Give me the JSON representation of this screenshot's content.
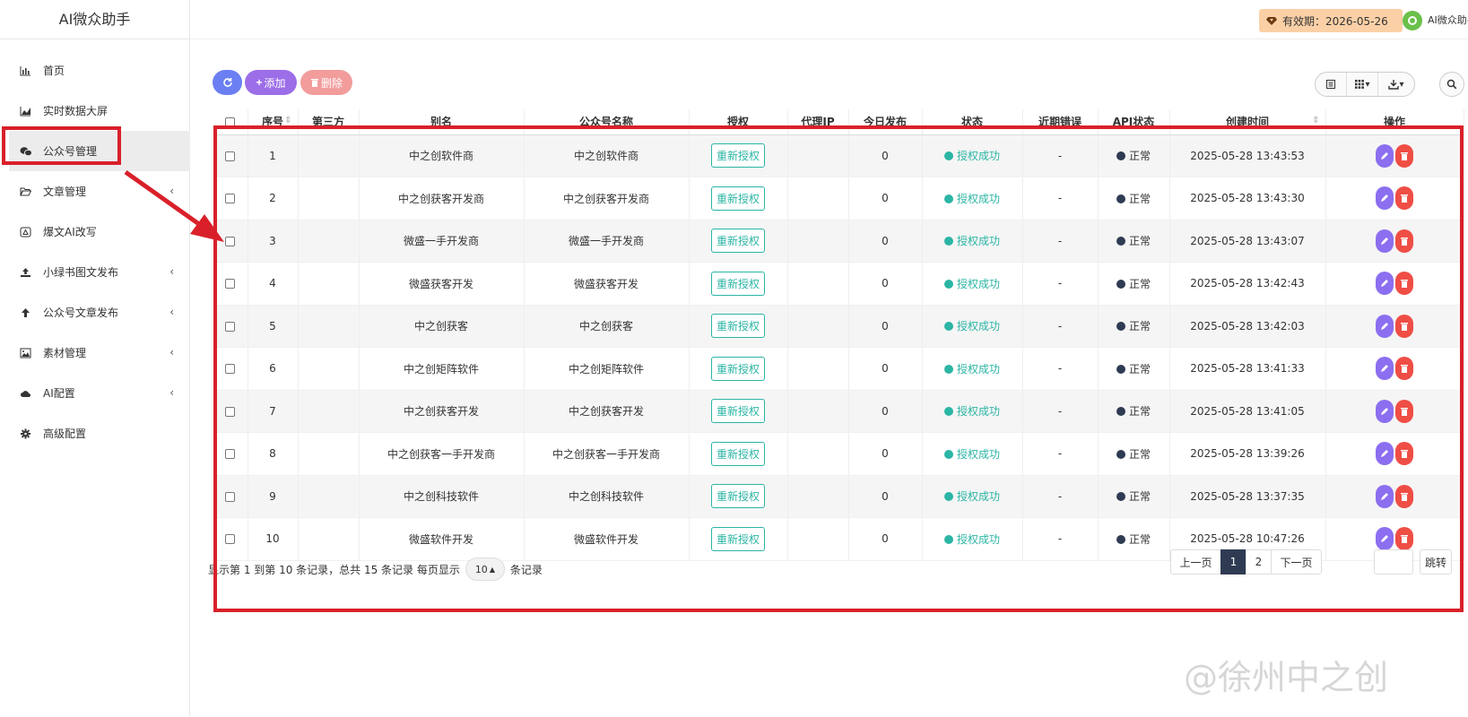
{
  "app": {
    "title": "AI微众助手"
  },
  "header": {
    "expiry_label": "有效期：2026-05-26",
    "user_name": "AI微众助手"
  },
  "sidebar": {
    "items": [
      {
        "label": "首页",
        "icon": "bar-chart-icon",
        "submenu": false,
        "active": false
      },
      {
        "label": "实时数据大屏",
        "icon": "area-chart-icon",
        "submenu": false,
        "active": false
      },
      {
        "label": "公众号管理",
        "icon": "wechat-icon",
        "submenu": false,
        "active": true
      },
      {
        "label": "文章管理",
        "icon": "folder-open-icon",
        "submenu": true,
        "active": false
      },
      {
        "label": "爆文AI改写",
        "icon": "drive-icon",
        "submenu": false,
        "active": false
      },
      {
        "label": "小绿书图文发布",
        "icon": "upload-icon",
        "submenu": true,
        "active": false
      },
      {
        "label": "公众号文章发布",
        "icon": "arrow-up-icon",
        "submenu": true,
        "active": false
      },
      {
        "label": "素材管理",
        "icon": "image-icon",
        "submenu": true,
        "active": false
      },
      {
        "label": "AI配置",
        "icon": "cloud-icon",
        "submenu": true,
        "active": false
      },
      {
        "label": "高级配置",
        "icon": "gear-icon",
        "submenu": false,
        "active": false
      }
    ]
  },
  "toolbar": {
    "add_label": "添加",
    "delete_label": "删除"
  },
  "table": {
    "columns": [
      "序号",
      "第三方",
      "别名",
      "公众号名称",
      "授权",
      "代理IP",
      "今日发布",
      "状态",
      "近期错误",
      "API状态",
      "创建时间",
      "操作"
    ],
    "reauth_label": "重新授权",
    "rows": [
      {
        "index": "1",
        "third": "",
        "alias": "中之创软件商",
        "name": "中之创软件商",
        "proxy": "",
        "today": "0",
        "status": "授权成功",
        "error": "-",
        "api": "正常",
        "created": "2025-05-28 13:43:53"
      },
      {
        "index": "2",
        "third": "",
        "alias": "中之创获客开发商",
        "name": "中之创获客开发商",
        "proxy": "",
        "today": "0",
        "status": "授权成功",
        "error": "-",
        "api": "正常",
        "created": "2025-05-28 13:43:30"
      },
      {
        "index": "3",
        "third": "",
        "alias": "微盛一手开发商",
        "name": "微盛一手开发商",
        "proxy": "",
        "today": "0",
        "status": "授权成功",
        "error": "-",
        "api": "正常",
        "created": "2025-05-28 13:43:07"
      },
      {
        "index": "4",
        "third": "",
        "alias": "微盛获客开发",
        "name": "微盛获客开发",
        "proxy": "",
        "today": "0",
        "status": "授权成功",
        "error": "-",
        "api": "正常",
        "created": "2025-05-28 13:42:43"
      },
      {
        "index": "5",
        "third": "",
        "alias": "中之创获客",
        "name": "中之创获客",
        "proxy": "",
        "today": "0",
        "status": "授权成功",
        "error": "-",
        "api": "正常",
        "created": "2025-05-28 13:42:03"
      },
      {
        "index": "6",
        "third": "",
        "alias": "中之创矩阵软件",
        "name": "中之创矩阵软件",
        "proxy": "",
        "today": "0",
        "status": "授权成功",
        "error": "-",
        "api": "正常",
        "created": "2025-05-28 13:41:33"
      },
      {
        "index": "7",
        "third": "",
        "alias": "中之创获客开发",
        "name": "中之创获客开发",
        "proxy": "",
        "today": "0",
        "status": "授权成功",
        "error": "-",
        "api": "正常",
        "created": "2025-05-28 13:41:05"
      },
      {
        "index": "8",
        "third": "",
        "alias": "中之创获客一手开发商",
        "name": "中之创获客一手开发商",
        "proxy": "",
        "today": "0",
        "status": "授权成功",
        "error": "-",
        "api": "正常",
        "created": "2025-05-28 13:39:26"
      },
      {
        "index": "9",
        "third": "",
        "alias": "中之创科技软件",
        "name": "中之创科技软件",
        "proxy": "",
        "today": "0",
        "status": "授权成功",
        "error": "-",
        "api": "正常",
        "created": "2025-05-28 13:37:35"
      },
      {
        "index": "10",
        "third": "",
        "alias": "微盛软件开发",
        "name": "微盛软件开发",
        "proxy": "",
        "today": "0",
        "status": "授权成功",
        "error": "-",
        "api": "正常",
        "created": "2025-05-28 10:47:26"
      }
    ]
  },
  "pagination": {
    "summary": "显示第 1 到第 10 条记录，总共 15 条记录 每页显示",
    "page_size": "10",
    "suffix": "条记录",
    "prev": "上一页",
    "pages": [
      "1",
      "2"
    ],
    "current": "1",
    "next": "下一页",
    "jump": "跳转"
  },
  "watermark": "@徐州中之创",
  "colors": {
    "accent": "#2bb5a4",
    "annotation": "#d9202a",
    "add": "#9c6ee8",
    "delete": "#f29c9c",
    "refresh": "#6b7ff2"
  }
}
